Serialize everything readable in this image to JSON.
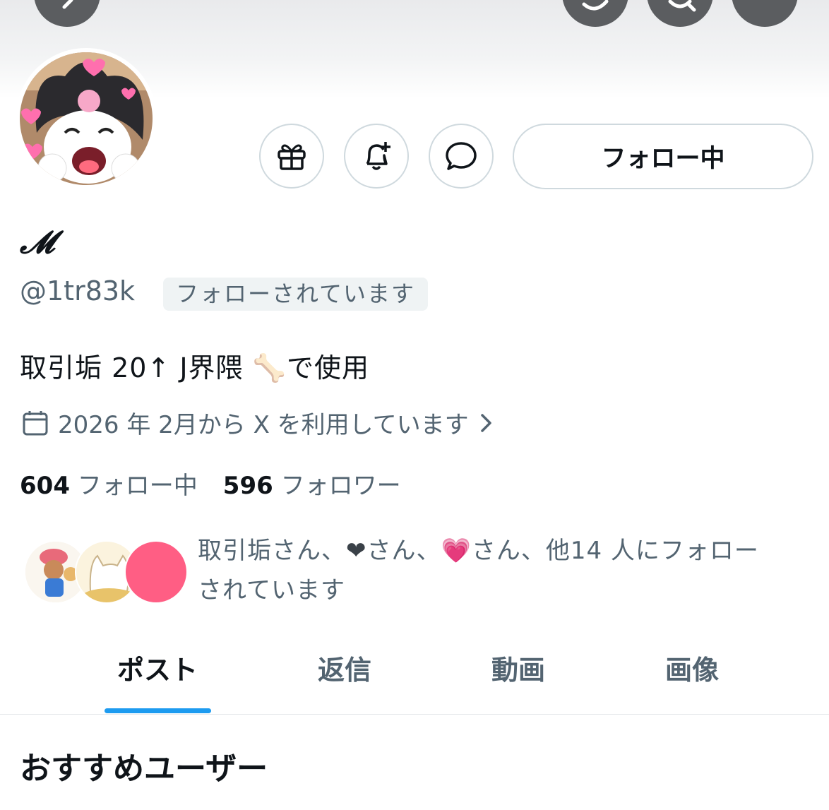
{
  "nav": {
    "back_icon": "chevron-left-icon",
    "grok_icon": "grok-icon",
    "search_icon": "search-icon",
    "more_icon": "more-icon"
  },
  "profile": {
    "display_name": "𝓜",
    "handle": "@1tr83k",
    "follows_you": "フォローされています",
    "bio": "取引垢 20↑ J界隈 🦴で使用",
    "joined": "2026 年 2月から X を利用しています",
    "following_count": "604",
    "following_label": "フォロー中",
    "followers_count": "596",
    "followers_label": "フォロワー"
  },
  "actions": {
    "follow_button_label": "フォロー中",
    "gift_icon": "gift-icon",
    "notify_icon": "bell-plus-icon",
    "message_icon": "message-icon"
  },
  "mutuals": {
    "part1": "取引垢さん、",
    "heart1": "❤",
    "part2": "さん、",
    "heart2": "💗",
    "part3": "さん、他14 人にフォロー",
    "part4": "されています"
  },
  "tabs": [
    {
      "label": "ポスト"
    },
    {
      "label": "返信"
    },
    {
      "label": "動画"
    },
    {
      "label": "画像"
    }
  ],
  "section": {
    "title": "おすすめユーザー"
  },
  "colors": {
    "accent": "#1d9bf0",
    "secondary_text": "#536471",
    "border": "#cfd9de",
    "mutual_avatar_pink": "#ff5e84"
  }
}
